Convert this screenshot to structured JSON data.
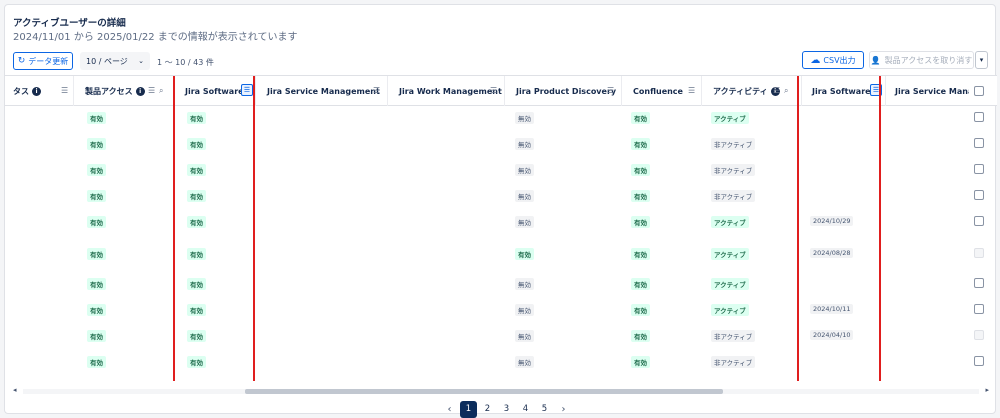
{
  "header": {
    "title": "アクティブユーザーの詳細",
    "subtitle": "2024/11/01 から 2025/01/22 までの情報が表示されています"
  },
  "toolbar": {
    "refresh_label": "データ更新",
    "per_page": "10 / ページ",
    "range_text": "1 〜 10 / 43 件",
    "csv_label": "CSV出力",
    "revoke_label": "製品アクセスを取り消す"
  },
  "columns": [
    {
      "label": "タス",
      "info": true
    },
    {
      "label": "製品アクセス",
      "info": true
    },
    {
      "label": "Jira Software"
    },
    {
      "label": "Jira Service Management"
    },
    {
      "label": "Jira Work Management"
    },
    {
      "label": "Jira Product Discovery"
    },
    {
      "label": "Confluence"
    },
    {
      "label": "アクティビティ",
      "info": true
    },
    {
      "label": "Jira Software"
    },
    {
      "label": "Jira Service Manage"
    }
  ],
  "rows": [
    {
      "product_access": "有効",
      "jira_software": "有効",
      "jpd": "無効",
      "confluence": "有効",
      "activity": "アクティブ",
      "last_active": "",
      "checkbox_enabled": true
    },
    {
      "product_access": "有効",
      "jira_software": "有効",
      "jpd": "無効",
      "confluence": "有効",
      "activity": "非アクティブ",
      "last_active": "",
      "checkbox_enabled": true
    },
    {
      "product_access": "有効",
      "jira_software": "有効",
      "jpd": "無効",
      "confluence": "有効",
      "activity": "非アクティブ",
      "last_active": "",
      "checkbox_enabled": true
    },
    {
      "product_access": "有効",
      "jira_software": "有効",
      "jpd": "無効",
      "confluence": "有効",
      "activity": "非アクティブ",
      "last_active": "",
      "checkbox_enabled": true
    },
    {
      "product_access": "有効",
      "jira_software": "有効",
      "jpd": "無効",
      "confluence": "有効",
      "activity": "アクティブ",
      "last_active": "2024/10/29",
      "checkbox_enabled": true
    },
    {
      "product_access": "有効",
      "jira_software": "有効",
      "jpd": "有効",
      "confluence": "有効",
      "activity": "アクティブ",
      "last_active": "2024/08/28",
      "checkbox_enabled": false
    },
    {
      "product_access": "有効",
      "jira_software": "有効",
      "jpd": "無効",
      "confluence": "有効",
      "activity": "アクティブ",
      "last_active": "",
      "checkbox_enabled": true
    },
    {
      "product_access": "有効",
      "jira_software": "有効",
      "jpd": "無効",
      "confluence": "有効",
      "activity": "アクティブ",
      "last_active": "2024/10/11",
      "checkbox_enabled": true
    },
    {
      "product_access": "有効",
      "jira_software": "有効",
      "jpd": "無効",
      "confluence": "有効",
      "activity": "非アクティブ",
      "last_active": "2024/04/10",
      "checkbox_enabled": false
    },
    {
      "product_access": "有効",
      "jira_software": "有効",
      "jpd": "無効",
      "confluence": "有効",
      "activity": "非アクティブ",
      "last_active": "",
      "checkbox_enabled": true
    }
  ],
  "pagination": {
    "pages": [
      "1",
      "2",
      "3",
      "4",
      "5"
    ],
    "current": "1",
    "prev_icon": "chevron-left-icon",
    "next_icon": "chevron-right-icon"
  },
  "colors": {
    "accent": "#0c66e4",
    "highlight": "#e01e1e",
    "active_page": "#0c2d5c"
  }
}
